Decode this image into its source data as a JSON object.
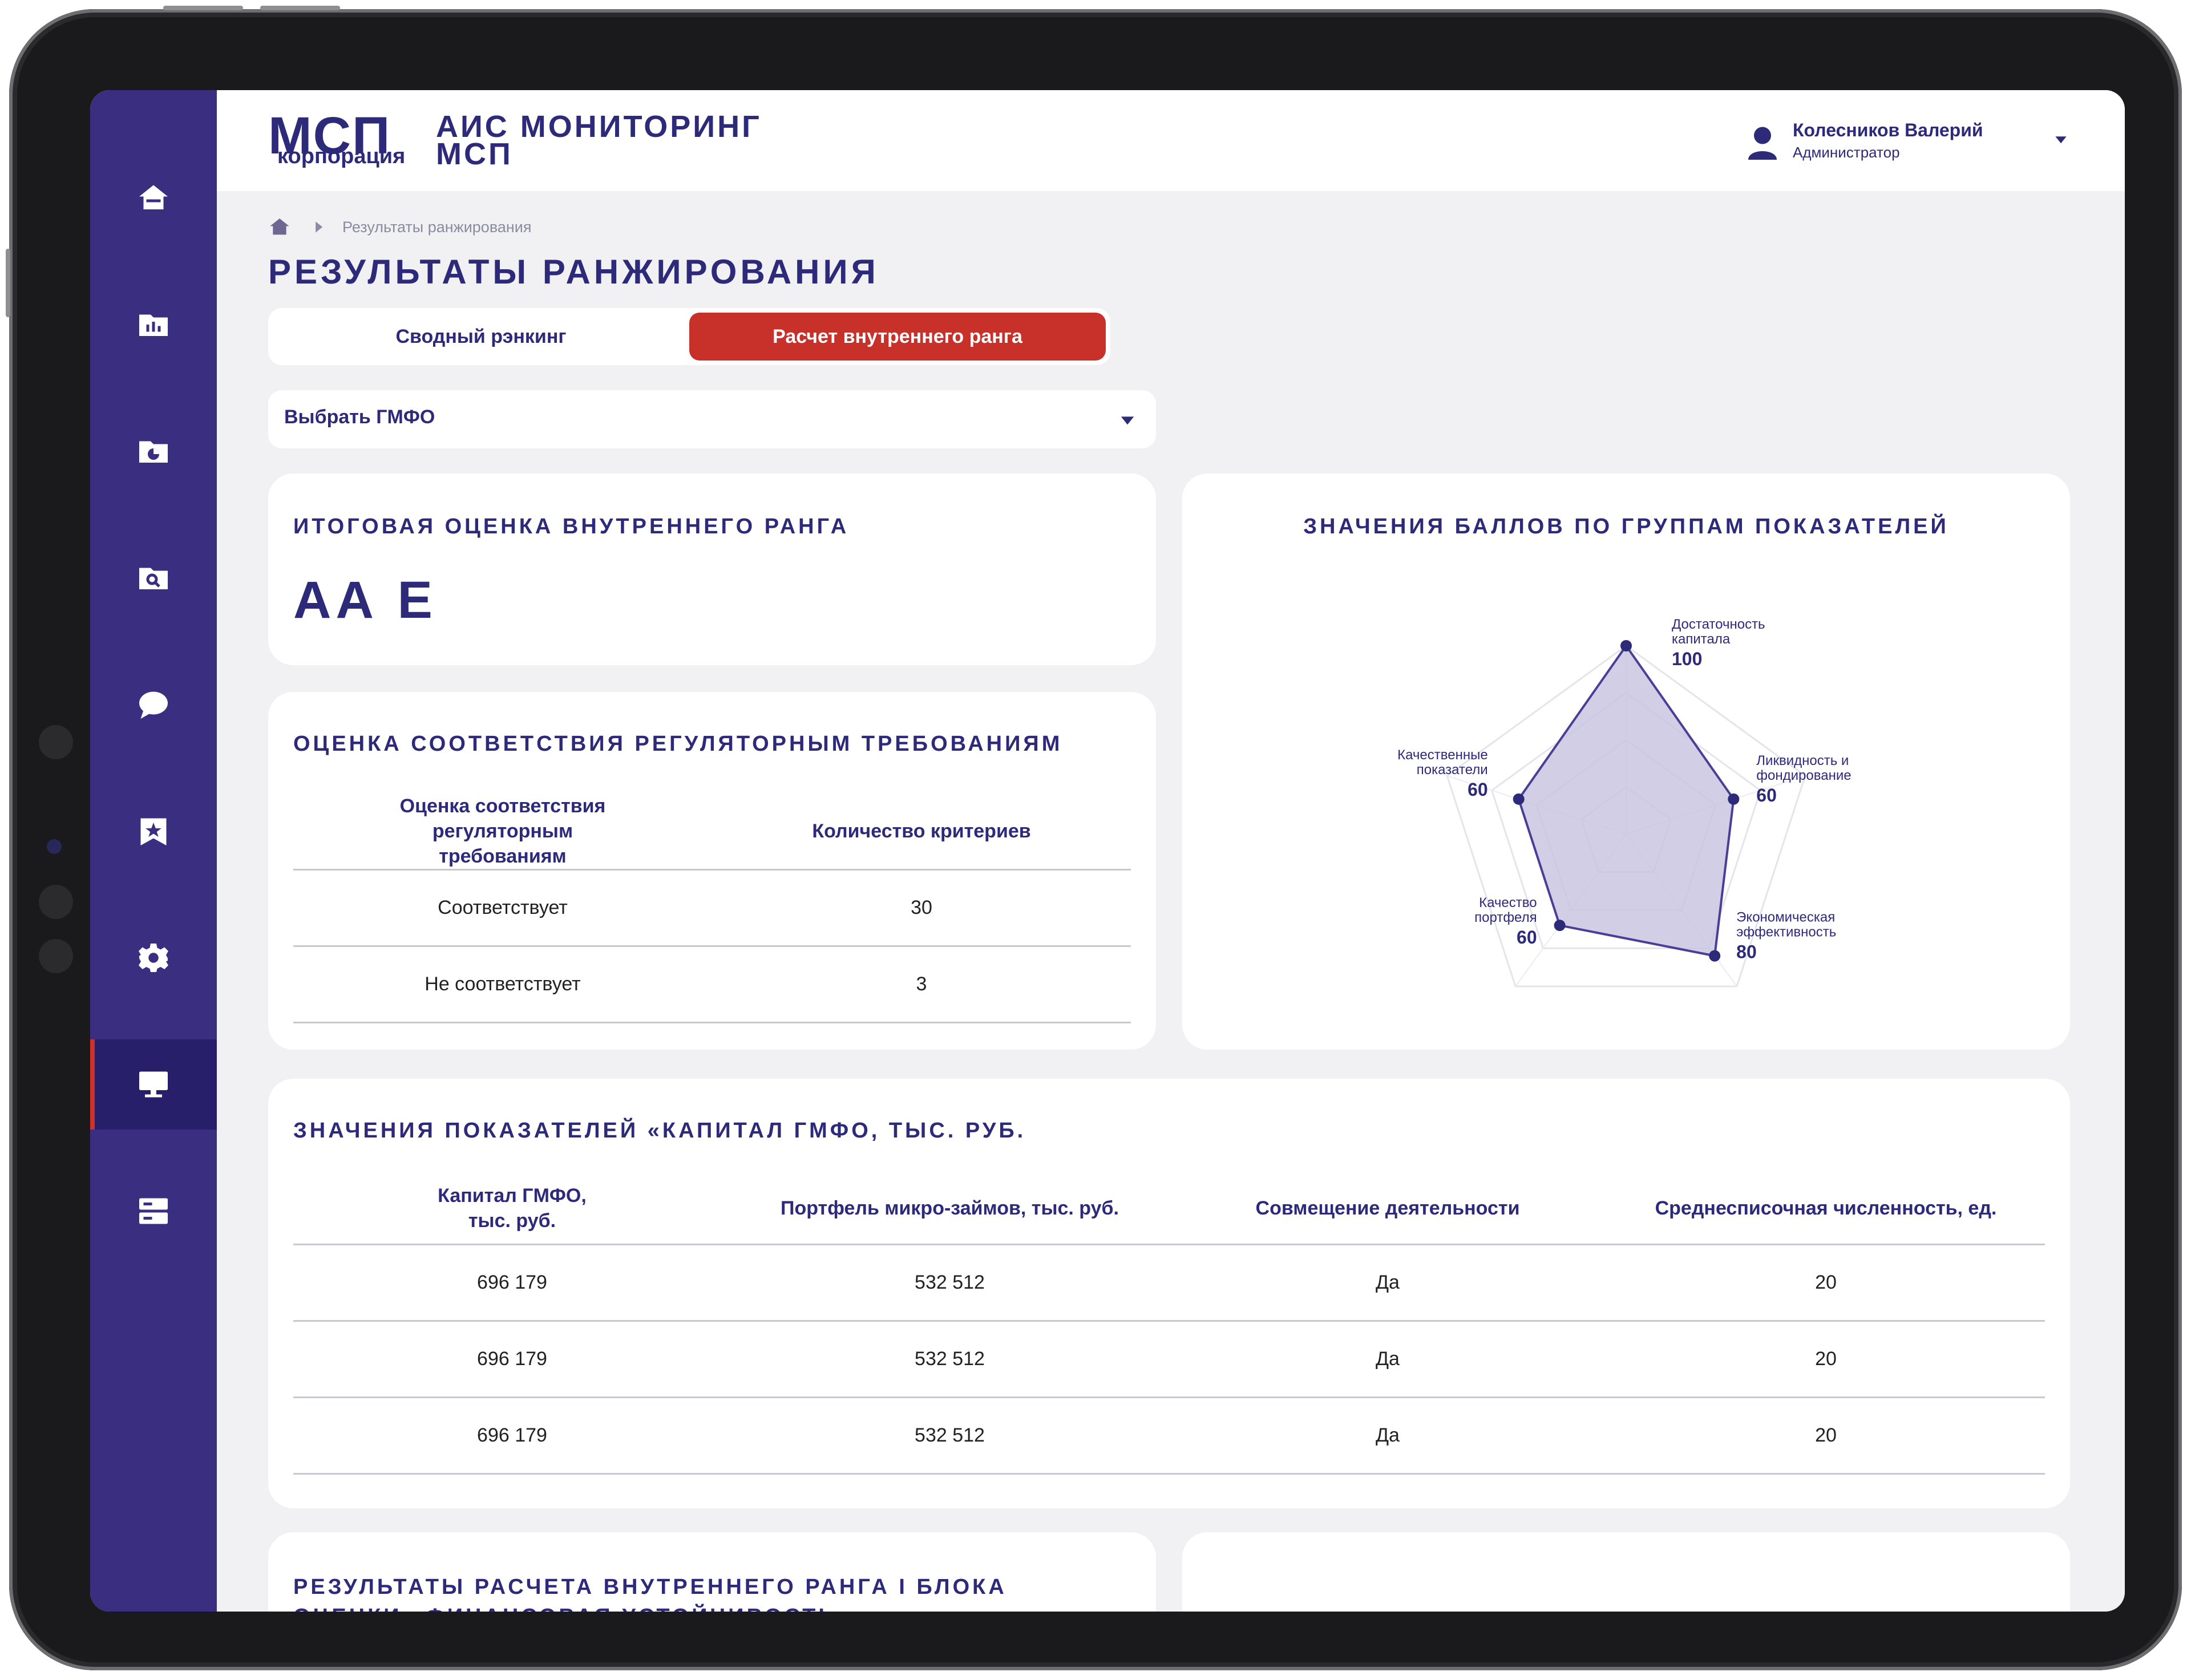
{
  "logo": {
    "main": "МСП",
    "sub": "корпорация"
  },
  "app": {
    "title_line1": "АИС Мониторинг",
    "title_line2": "МСП"
  },
  "user": {
    "name": "Колесников Валерий",
    "role": "Администратор"
  },
  "sidebar": {
    "items": [
      {
        "icon": "home-icon"
      },
      {
        "icon": "chart-folder-icon"
      },
      {
        "icon": "pie-folder-icon"
      },
      {
        "icon": "search-document-icon"
      },
      {
        "icon": "chat-bubble-icon"
      },
      {
        "icon": "star-bookmark-icon"
      },
      {
        "icon": "gear-icon"
      },
      {
        "icon": "monitor-icon",
        "active": true
      },
      {
        "icon": "server-icon"
      }
    ],
    "accent_color": "#d0302a",
    "bg_color": "#392e80"
  },
  "breadcrumb": {
    "current": "Результаты ранжирования"
  },
  "page": {
    "title": "Результаты ранжирования"
  },
  "tabs": [
    {
      "label": "Сводный рэнкинг",
      "active": false
    },
    {
      "label": "Расчет внутреннего ранга",
      "active": true
    }
  ],
  "select": {
    "label": "Выбрать ГМФО"
  },
  "rank_card": {
    "title": "Итоговая оценка внутреннего ранга",
    "value": "АА Е"
  },
  "compliance": {
    "title": "Оценка соответствия регуляторным требованиям",
    "headers": [
      "Оценка соответствия регуляторным требованиям",
      "Количество критериев"
    ],
    "rows": [
      [
        "Соответствует",
        "30"
      ],
      [
        "Не соответствует",
        "3"
      ]
    ]
  },
  "radar_card": {
    "title": "Значения баллов по группам показателей"
  },
  "chart_data": {
    "type": "radar",
    "title": "Значения баллов по группам показателей",
    "axes": [
      "Достаточность капитала",
      "Ликвидность и фондирование",
      "Экономическая эффективность",
      "Качество портфеля",
      "Качественные показатели"
    ],
    "values": [
      100,
      60,
      80,
      60,
      60
    ],
    "rlim": [
      0,
      100
    ],
    "rings": 4,
    "fill_color": "#c9c6e2",
    "line_color": "#4a3f96"
  },
  "capital": {
    "title": "Значения показателей «Капитал ГМФО, тыс. руб.",
    "headers": [
      "Капитал ГМФО, тыс. руб.",
      "Портфель микро-займов, тыс. руб.",
      "Совмещение деятельности",
      "Среднесписочная численность, ед."
    ],
    "rows": [
      [
        "696 179",
        "532 512",
        "Да",
        "20"
      ],
      [
        "696 179",
        "532 512",
        "Да",
        "20"
      ],
      [
        "696 179",
        "532 512",
        "Да",
        "20"
      ]
    ]
  },
  "block_results": {
    "title_line1": "Результаты расчета внутреннего ранга I блока",
    "title_line2": "оценки «Финансовая устойчивость»"
  }
}
